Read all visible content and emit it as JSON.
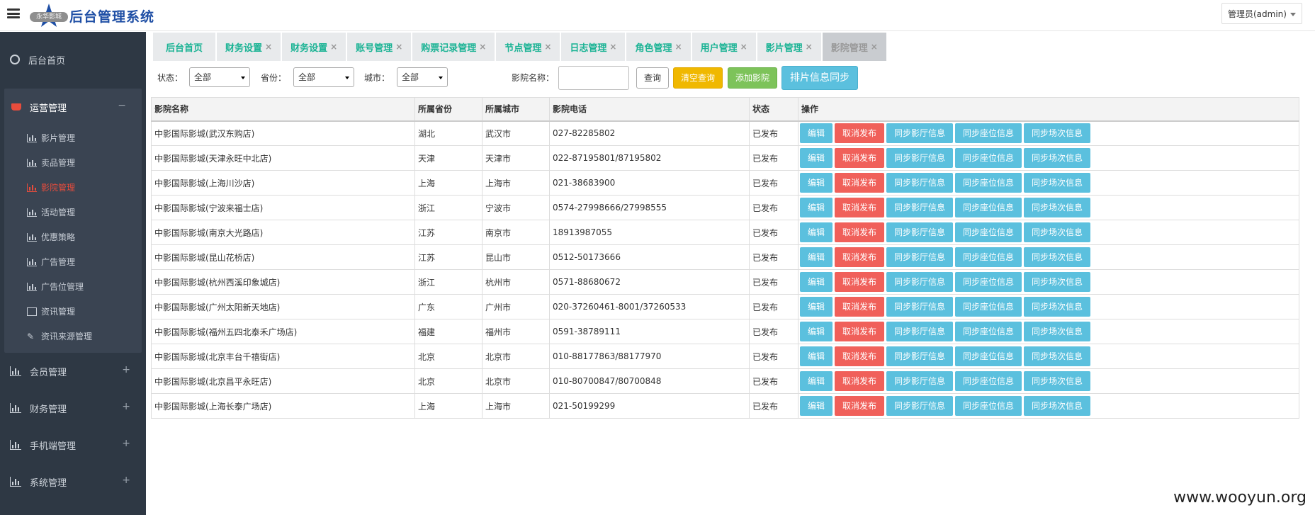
{
  "header": {
    "logo_pill": "永华影城",
    "title": "后台管理系统",
    "user_selected": "管理员(admin)"
  },
  "sidebar": {
    "groups": [
      {
        "label": "后台首页",
        "toggle": ""
      },
      {
        "label": "运营管理",
        "toggle": "−"
      },
      {
        "label": "会员管理",
        "toggle": "+"
      },
      {
        "label": "财务管理",
        "toggle": "+"
      },
      {
        "label": "手机端管理",
        "toggle": "+"
      },
      {
        "label": "系统管理",
        "toggle": "+"
      }
    ],
    "sub_items": [
      {
        "label": "影片管理",
        "icon": "bar-chart-icon"
      },
      {
        "label": "卖品管理",
        "icon": "bar-chart-icon"
      },
      {
        "label": "影院管理",
        "icon": "bar-chart-icon"
      },
      {
        "label": "活动管理",
        "icon": "bar-chart-icon"
      },
      {
        "label": "优惠策略",
        "icon": "bar-chart-icon"
      },
      {
        "label": "广告管理",
        "icon": "bar-chart-icon"
      },
      {
        "label": "广告位管理",
        "icon": "bar-chart-icon"
      },
      {
        "label": "资讯管理",
        "icon": "news-icon"
      },
      {
        "label": "资讯来源管理",
        "icon": "wand-icon"
      }
    ],
    "active_color": "#e74c3c"
  },
  "tabs": [
    {
      "label": "后台首页",
      "closable": false
    },
    {
      "label": "财务设置",
      "closable": true
    },
    {
      "label": "财务设置",
      "closable": true
    },
    {
      "label": "账号管理",
      "closable": true
    },
    {
      "label": "购票记录管理",
      "closable": true
    },
    {
      "label": "节点管理",
      "closable": true
    },
    {
      "label": "日志管理",
      "closable": true
    },
    {
      "label": "角色管理",
      "closable": true
    },
    {
      "label": "用户管理",
      "closable": true
    },
    {
      "label": "影片管理",
      "closable": true
    },
    {
      "label": "影院管理",
      "closable": true
    }
  ],
  "tab_close_glyph": "×",
  "filters": {
    "status_label": "状态：",
    "status_value": "全部",
    "province_label": "省份：",
    "province_value": "全部",
    "city_label": "城市：",
    "city_value": "全部",
    "name_label": "影院名称：",
    "name_value": "",
    "query_button": "查询",
    "clear_button": "清空查询",
    "add_button": "添加影院",
    "sync_button": "排片信息同步"
  },
  "table": {
    "headers": [
      "影院名称",
      "所属省份",
      "所属城市",
      "影院电话",
      "状态",
      "操作"
    ],
    "actions": [
      "编辑",
      "取消发布",
      "同步影厅信息",
      "同步座位信息",
      "同步场次信息"
    ],
    "rows": [
      [
        "中影国际影城(武汉东购店)",
        "湖北",
        "武汉市",
        "027-82285802",
        "已发布"
      ],
      [
        "中影国际影城(天津永旺中北店)",
        "天津",
        "天津市",
        "022-87195801/87195802",
        "已发布"
      ],
      [
        "中影国际影城(上海川沙店)",
        "上海",
        "上海市",
        "021-38683900",
        "已发布"
      ],
      [
        "中影国际影城(宁波来福士店)",
        "浙江",
        "宁波市",
        "0574-27998666/27998555",
        "已发布"
      ],
      [
        "中影国际影城(南京大光路店)",
        "江苏",
        "南京市",
        "18913987055",
        "已发布"
      ],
      [
        "中影国际影城(昆山花桥店)",
        "江苏",
        "昆山市",
        "0512-50173666",
        "已发布"
      ],
      [
        "中影国际影城(杭州西溪印象城店)",
        "浙江",
        "杭州市",
        "0571-88680672",
        "已发布"
      ],
      [
        "中影国际影城(广州太阳新天地店)",
        "广东",
        "广州市",
        "020-37260461-8001/37260533",
        "已发布"
      ],
      [
        "中影国际影城(福州五四北泰禾广场店)",
        "福建",
        "福州市",
        "0591-38789111",
        "已发布"
      ],
      [
        "中影国际影城(北京丰台千禧街店)",
        "北京",
        "北京市",
        "010-88177863/88177970",
        "已发布"
      ],
      [
        "中影国际影城(北京昌平永旺店)",
        "北京",
        "北京市",
        "010-80700847/80700848",
        "已发布"
      ],
      [
        "中影国际影城(上海长泰广场店)",
        "上海",
        "上海市",
        "021-50199299",
        "已发布"
      ]
    ]
  },
  "watermark": "www.wooyun.org"
}
